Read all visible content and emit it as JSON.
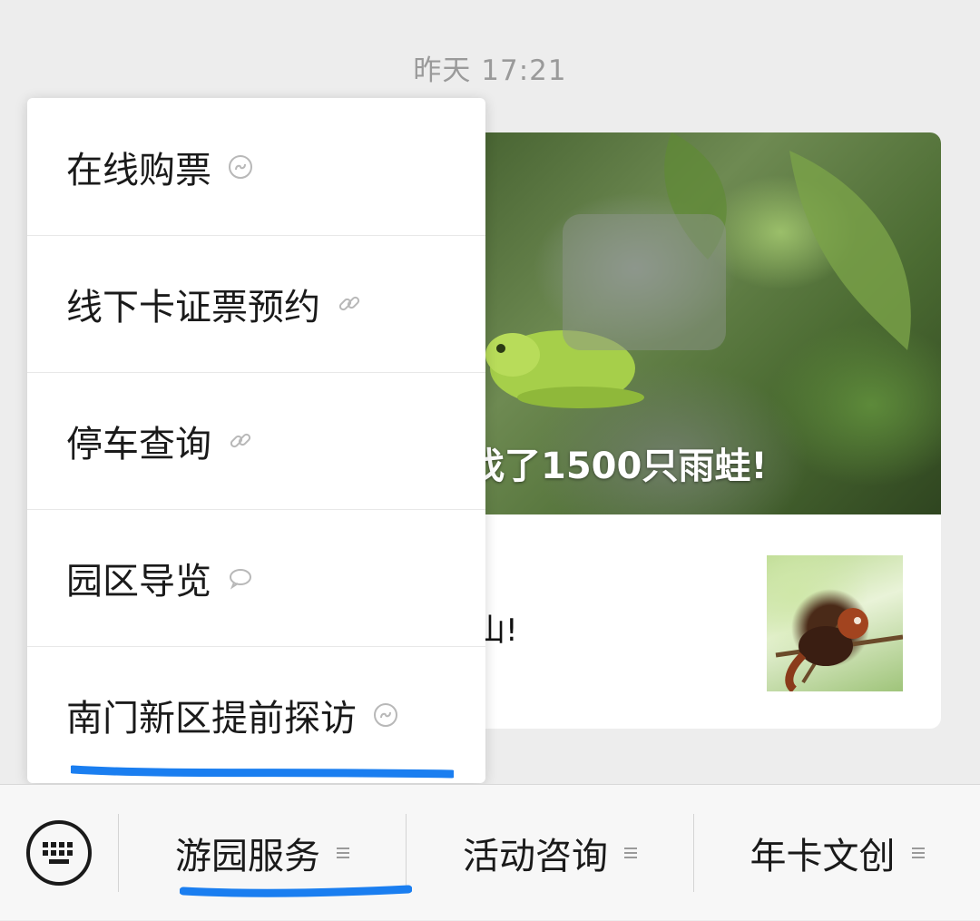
{
  "chat": {
    "timestamp": "昨天 17:21"
  },
  "article": {
    "cover_title": "找了1500只雨蛙!",
    "second_title": "山!",
    "cover_icon": "frog-photo",
    "thumb_icon": "red-panda-photo"
  },
  "menu": {
    "items": [
      {
        "label": "在线购票",
        "icon": "mini-program-icon"
      },
      {
        "label": "线下卡证票预约",
        "icon": "link-icon"
      },
      {
        "label": "停车查询",
        "icon": "link-icon"
      },
      {
        "label": "园区导览",
        "icon": "message-icon"
      },
      {
        "label": "南门新区提前探访",
        "icon": "mini-program-icon"
      }
    ],
    "highlight_color": "#1a7ef0"
  },
  "bottombar": {
    "keyboard_icon": "keyboard-icon",
    "tabs": [
      {
        "label": "游园服务",
        "icon": "menu-lines-icon"
      },
      {
        "label": "活动咨询",
        "icon": "menu-lines-icon"
      },
      {
        "label": "年卡文创",
        "icon": "menu-lines-icon"
      }
    ]
  }
}
